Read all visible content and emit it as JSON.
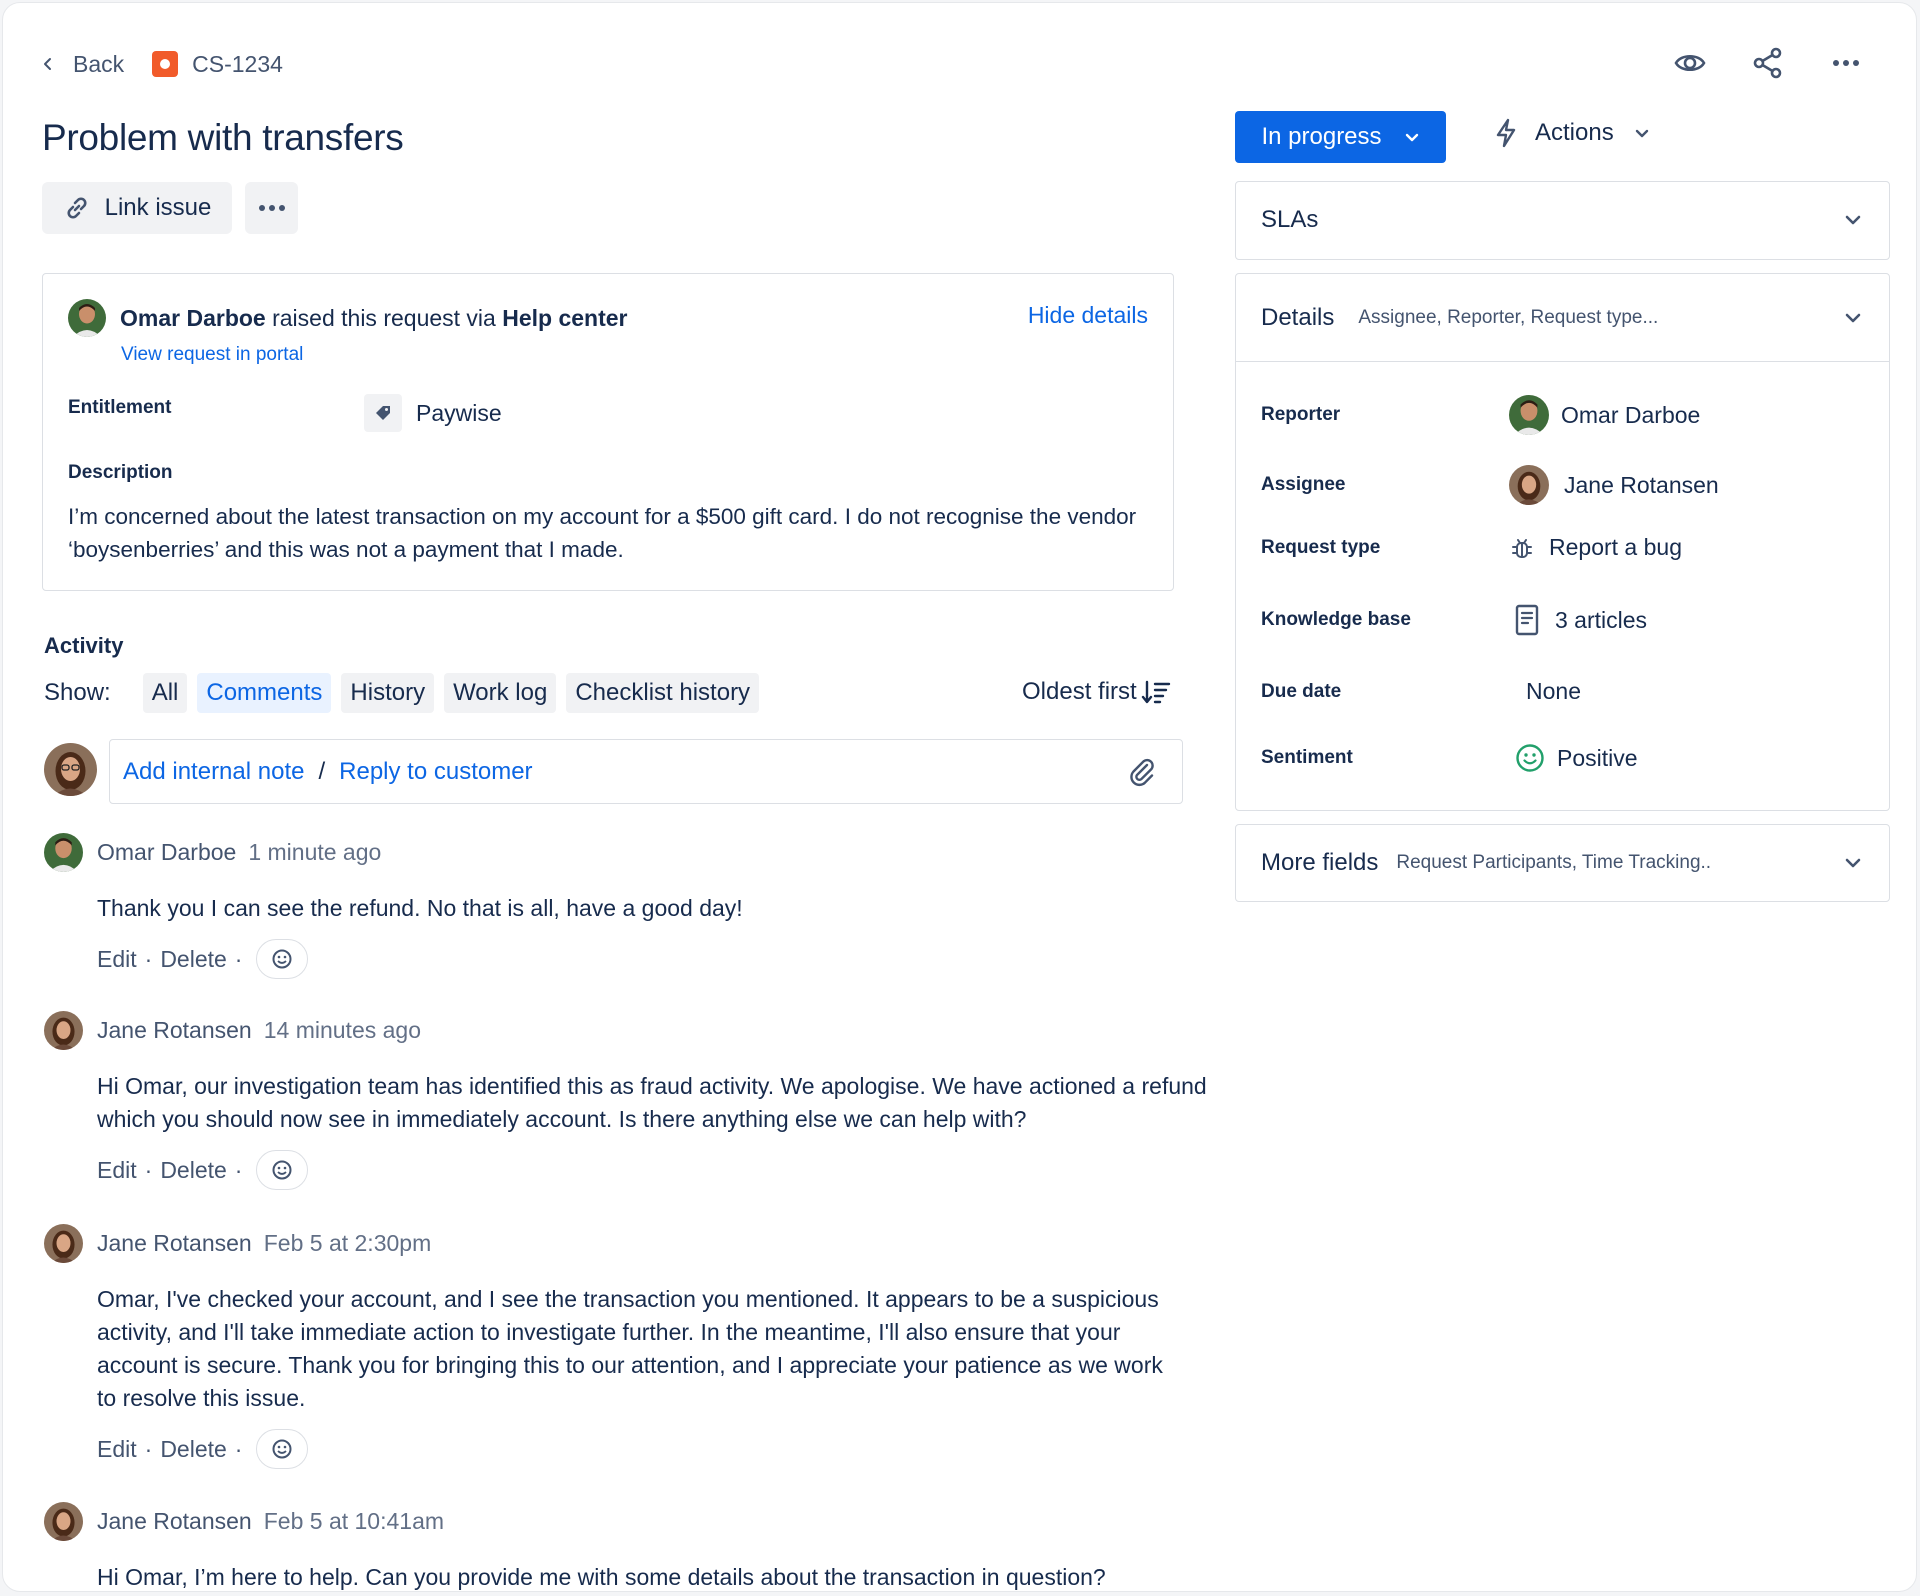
{
  "nav": {
    "back_label": "Back",
    "issue_key": "CS-1234"
  },
  "issue": {
    "title": "Problem with transfers"
  },
  "buttons": {
    "link_issue": "Link issue"
  },
  "request": {
    "reporter_name": "Omar Darboe",
    "raised_text": "raised this request via",
    "channel": "Help center",
    "hide_details": "Hide details",
    "view_portal": "View request in portal",
    "entitlement_label": "Entitlement",
    "entitlement_value": "Paywise",
    "description_label": "Description",
    "description": "I’m concerned about the latest transaction on my account for a $500 gift card. I do not recognise the vendor ‘boysenberries’ and this was not a payment that I made."
  },
  "activity": {
    "heading": "Activity",
    "show_label": "Show:",
    "filters": [
      "All",
      "Comments",
      "History",
      "Work log",
      "Checklist history"
    ],
    "active_filter": "Comments",
    "sort_label": "Oldest first",
    "add_internal_note": "Add internal note",
    "separator": "/",
    "reply_to_customer": "Reply to customer"
  },
  "comment_actions": {
    "edit": "Edit",
    "dot": "·",
    "delete": "Delete"
  },
  "comments": [
    {
      "author": "Omar Darboe",
      "time": "1 minute ago",
      "body": "Thank you I can see the refund. No that is all, have a good day!",
      "avatar": "omar"
    },
    {
      "author": "Jane Rotansen",
      "time": "14 minutes ago",
      "body": "Hi Omar, our investigation team has identified this as fraud activity. We apologise. We have actioned a refund which you should now see in immediately account. Is there anything else we can help with?",
      "avatar": "jane"
    },
    {
      "author": "Jane Rotansen",
      "time": "Feb 5 at 2:30pm",
      "body": "Omar, I've checked your account, and I see the transaction you mentioned. It appears to be a suspicious activity, and I'll take immediate action to investigate further. In the meantime, I'll also ensure that your account is secure. Thank you for bringing this to our attention, and I appreciate your patience as we work to resolve this issue.",
      "avatar": "jane"
    },
    {
      "author": "Jane Rotansen",
      "time": "Feb 5 at 10:41am",
      "body": "Hi Omar, I’m here to help. Can you provide me with some details about the transaction in question?",
      "avatar": "jane"
    }
  ],
  "status": {
    "label": "In progress",
    "color": "#0c66e4"
  },
  "actions": {
    "label": "Actions"
  },
  "slas": {
    "label": "SLAs"
  },
  "details": {
    "label": "Details",
    "summary": "Assignee, Reporter, Request type...",
    "rows": [
      {
        "label": "Reporter",
        "value": "Omar Darboe",
        "icon": "avatar-omar"
      },
      {
        "label": "Assignee",
        "value": "Jane Rotansen",
        "icon": "avatar-jane"
      },
      {
        "label": "Request type",
        "value": "Report a bug",
        "icon": "bug-icon"
      },
      {
        "label": "Knowledge base",
        "value": "3 articles",
        "icon": "document-icon"
      },
      {
        "label": "Due date",
        "value": "None",
        "icon": ""
      },
      {
        "label": "Sentiment",
        "value": "Positive",
        "icon": "smile-icon"
      }
    ]
  },
  "more_fields": {
    "label": "More fields",
    "summary": "Request Participants, Time Tracking.."
  }
}
